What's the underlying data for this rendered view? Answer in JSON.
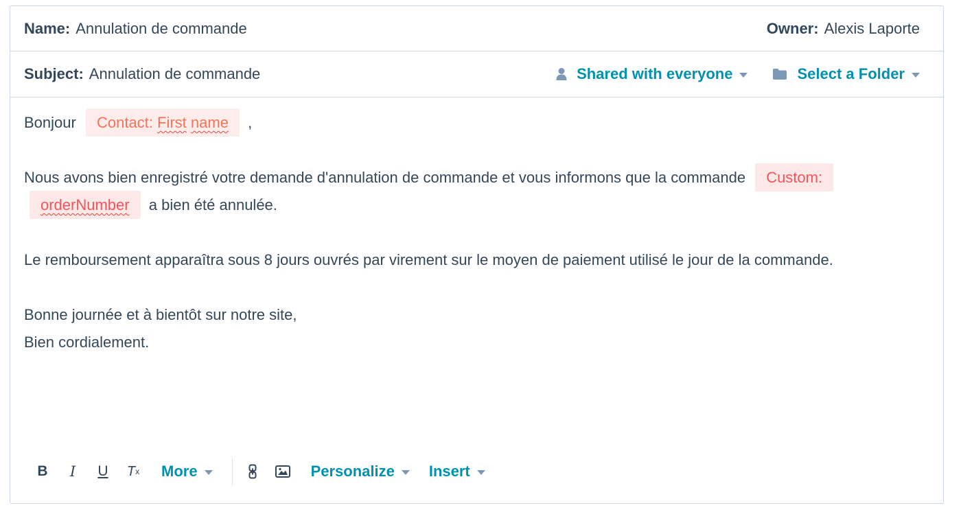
{
  "header": {
    "name_label": "Name:",
    "name_value": "Annulation de commande",
    "owner_label": "Owner:",
    "owner_value": "Alexis Laporte",
    "subject_label": "Subject:",
    "subject_value": "Annulation de commande",
    "sharing_label": "Shared with everyone",
    "sharing_icon": "user-icon",
    "folder_label": "Select a Folder",
    "folder_icon": "folder-icon"
  },
  "body": {
    "greeting": "Bonjour",
    "contact_token_prefix": "Contact:",
    "contact_token_w1": "First",
    "contact_token_w2": "name",
    "greeting_comma": ",",
    "p1_text": "Nous avons bien enregistré votre demande d'annulation de commande et vous informons que la commande",
    "custom_token_prefix": "Custom:",
    "custom_token_field": "orderNumber",
    "p1_tail": "a bien été annulée.",
    "p2": "Le remboursement apparaîtra sous 8 jours ouvrés par virement sur le moyen de paiement utilisé le jour de la commande.",
    "p3": "Bonne journée et à bientôt sur notre site,",
    "p4": "Bien cordialement."
  },
  "toolbar": {
    "bold": "B",
    "italic": "I",
    "underline": "U",
    "clear_format": "T",
    "clear_format_sub": "x",
    "more": "More",
    "link_icon": "link-icon",
    "image_icon": "image-icon",
    "personalize": "Personalize",
    "insert": "Insert"
  },
  "colors": {
    "accent": "#0091ae",
    "text": "#33475b",
    "border": "#cbd6e2",
    "contact_token_bg": "#fdedea",
    "contact_token_text": "#f2735a",
    "custom_token_bg": "#fde8e8",
    "custom_token_text": "#f2545b",
    "icon_muted": "#7c98b6"
  }
}
